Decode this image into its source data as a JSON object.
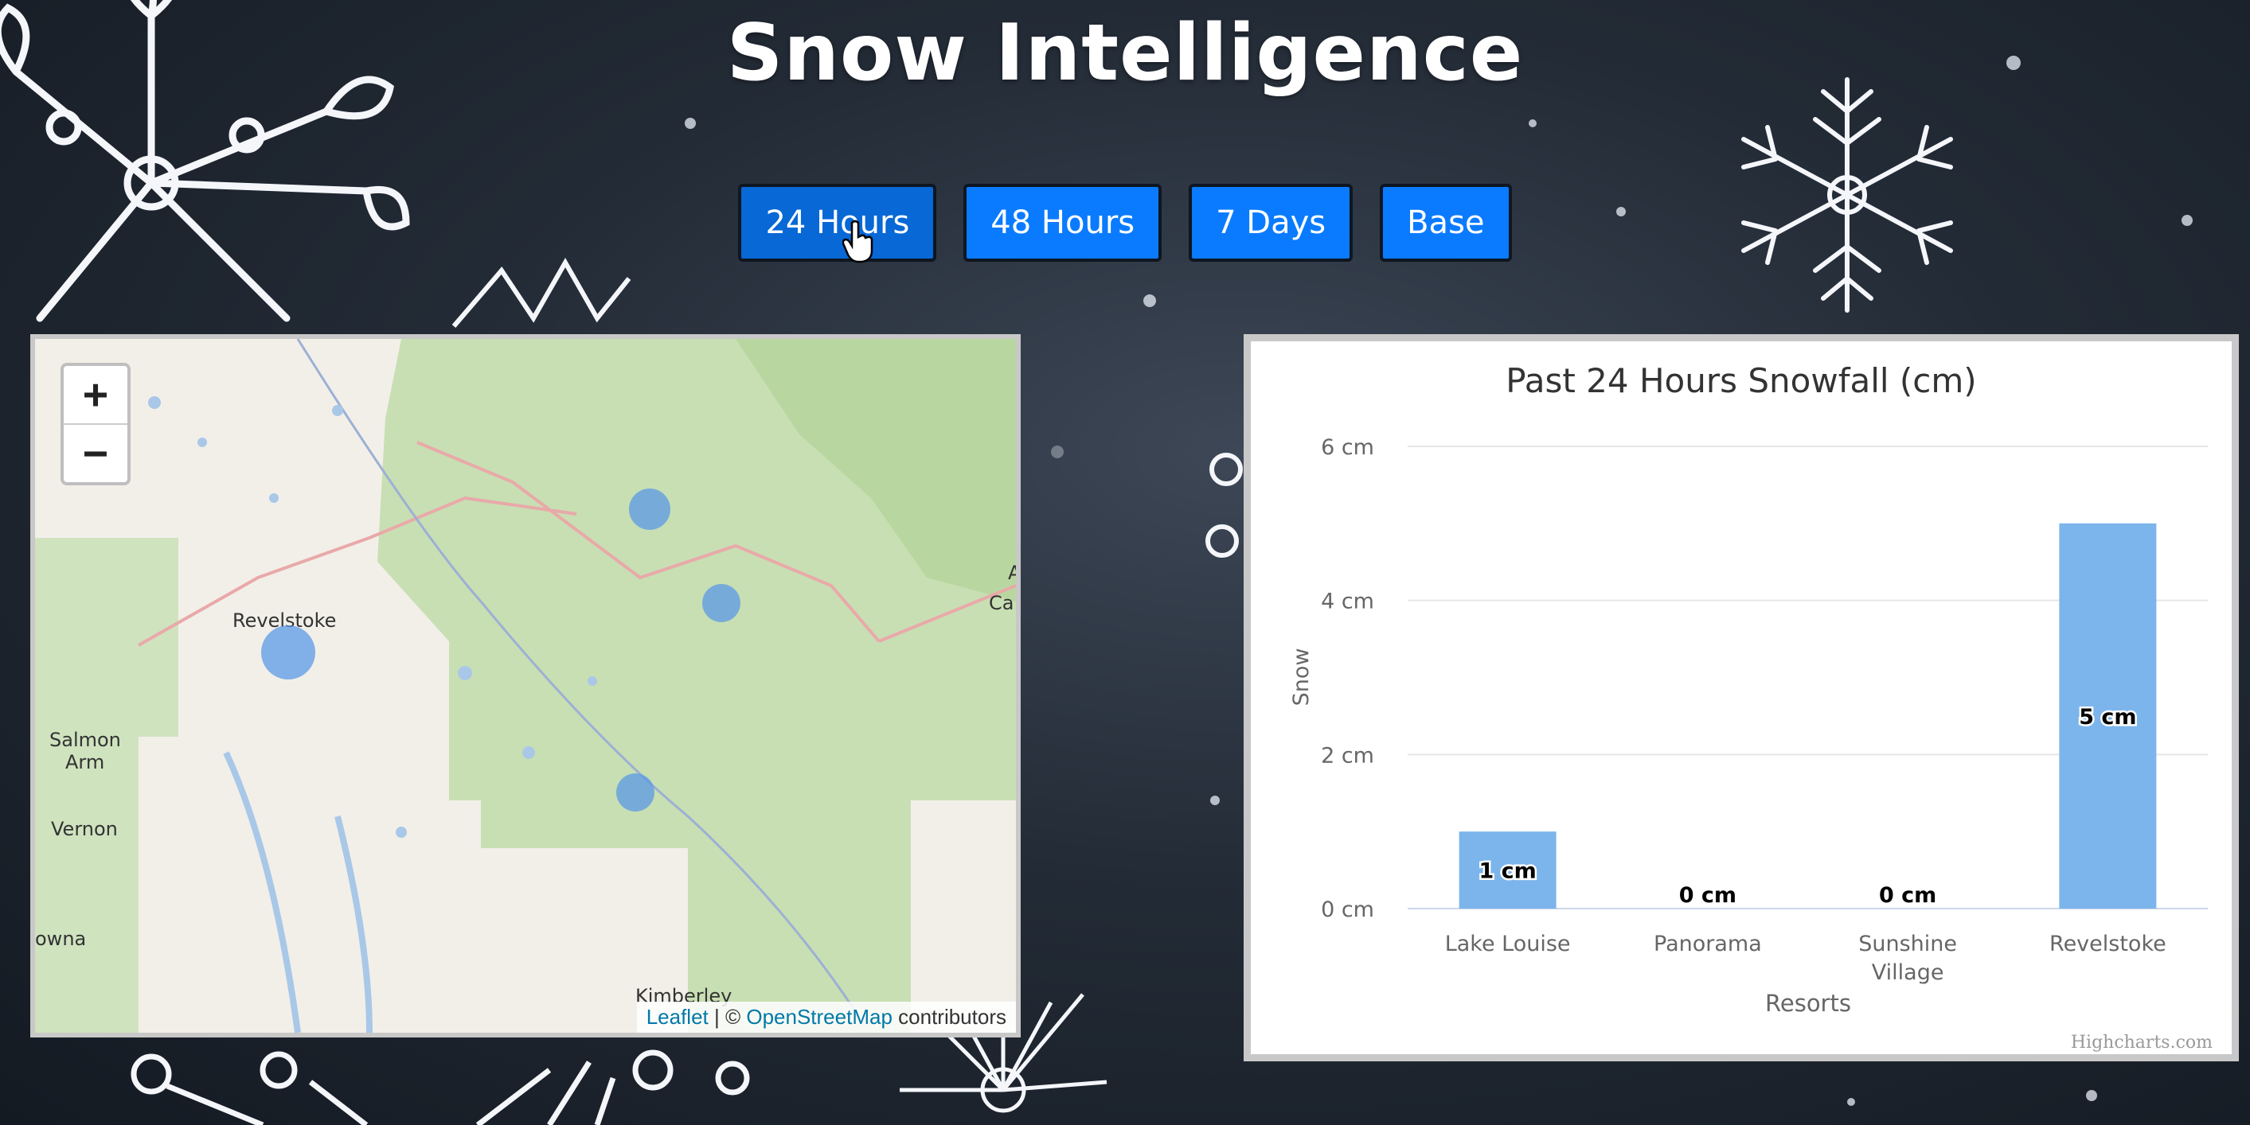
{
  "header": {
    "title": "Snow Intelligence"
  },
  "buttons": [
    {
      "label": "24 Hours",
      "active": true
    },
    {
      "label": "48 Hours",
      "active": false
    },
    {
      "label": "7 Days",
      "active": false
    },
    {
      "label": "Base",
      "active": false
    }
  ],
  "map": {
    "zoom_in": "+",
    "zoom_out": "−",
    "labels": {
      "revelstoke": "Revelstoke",
      "salmon": "Salmon",
      "arm": "Arm",
      "vernon": "Vernon",
      "kelowna": "owna",
      "kimberley": "Kimberley",
      "calgary": "Ca",
      "calgary_a": "A"
    },
    "attribution": {
      "leaflet": "Leaflet",
      "sep": " | © ",
      "osm": "OpenStreetMap",
      "contributors": " contributors"
    }
  },
  "chart_data": {
    "type": "bar",
    "title": "Past 24 Hours Snowfall (cm)",
    "categories": [
      [
        "Lake Louise"
      ],
      [
        "Panorama"
      ],
      [
        "Sunshine",
        "Village"
      ],
      [
        "Revelstoke"
      ]
    ],
    "values": [
      1,
      0,
      0,
      5
    ],
    "data_labels": [
      "1 cm",
      "0 cm",
      "0 cm",
      "5 cm"
    ],
    "ylim": [
      0,
      6
    ],
    "yticks": [
      0,
      2,
      4,
      6
    ],
    "ytick_labels": [
      "0 cm",
      "2 cm",
      "4 cm",
      "6 cm"
    ],
    "ylabel": "Snow",
    "xlabel": "Resorts",
    "bar_color": "#7cb5ec",
    "grid": true,
    "credits": "Highcharts.com"
  }
}
